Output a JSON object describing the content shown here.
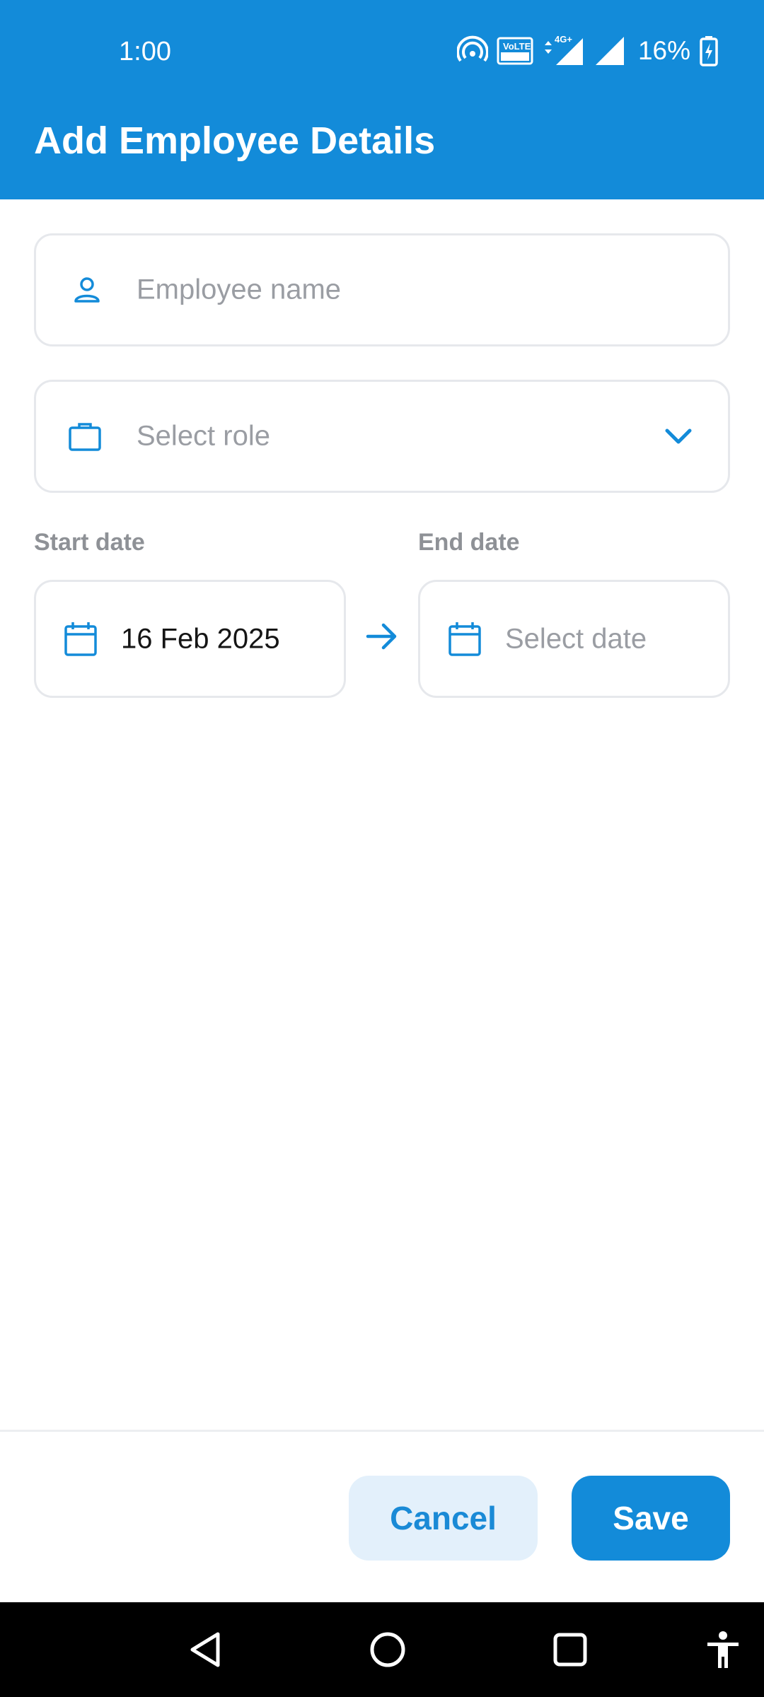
{
  "status_bar": {
    "time": "1:00",
    "battery_percent": "16%",
    "network_label": "4G+",
    "volte_label": "VoLTE",
    "icons": [
      "hotspot-icon",
      "volte-icon",
      "signal-4g-icon",
      "signal-icon",
      "battery-charging-icon"
    ]
  },
  "header": {
    "title": "Add Employee Details"
  },
  "form": {
    "employee_name": {
      "placeholder": "Employee name",
      "value": "",
      "icon": "person-icon"
    },
    "role": {
      "placeholder": "Select role",
      "value": "",
      "icon": "briefcase-icon",
      "dropdown_icon": "chevron-down-icon"
    },
    "start_date": {
      "label": "Start date",
      "value": "16 Feb 2025",
      "icon": "calendar-icon"
    },
    "end_date": {
      "label": "End date",
      "placeholder": "Select date",
      "value": "",
      "icon": "calendar-icon"
    }
  },
  "actions": {
    "cancel_label": "Cancel",
    "save_label": "Save"
  },
  "nav_bar": {
    "icons": [
      "back-icon",
      "home-icon",
      "recents-icon",
      "accessibility-icon"
    ]
  },
  "colors": {
    "primary": "#138bd9",
    "cancel_bg": "#e3f0fb",
    "placeholder": "#9a9da3",
    "label": "#8e9196",
    "border": "#e6e8ec"
  }
}
